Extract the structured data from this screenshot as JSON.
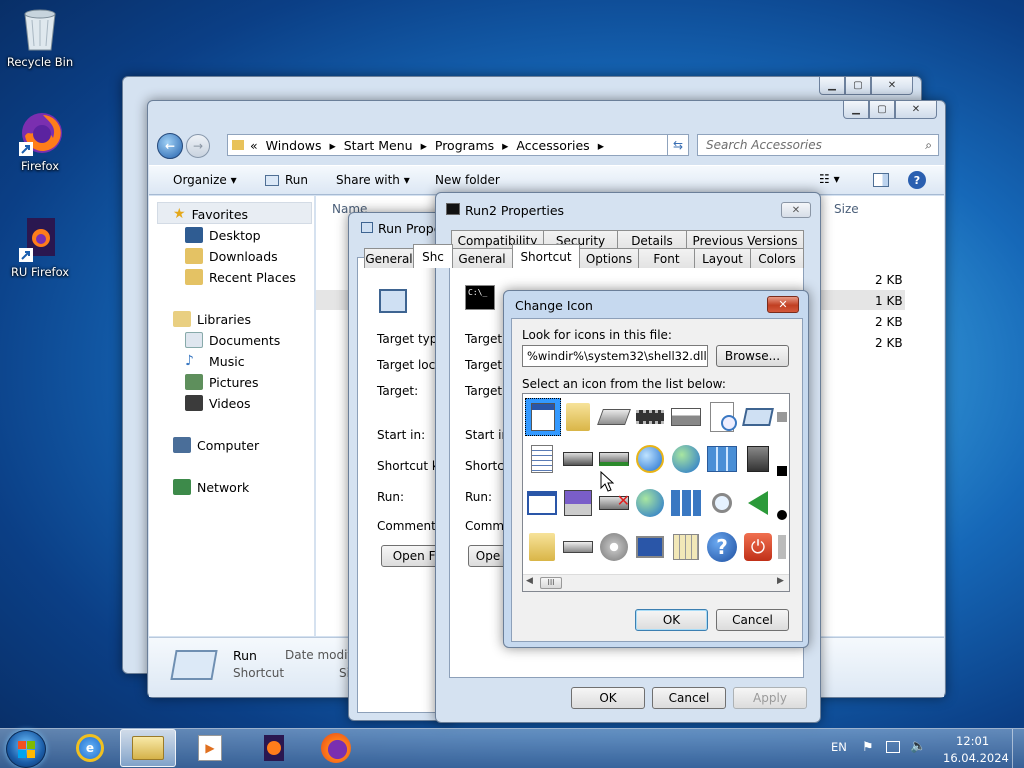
{
  "desktop": {
    "icons": [
      {
        "label": "Recycle Bin",
        "icon": "recycle-bin-icon"
      },
      {
        "label": "Firefox",
        "icon": "firefox-icon"
      },
      {
        "label": "RU Firefox",
        "icon": "firefox-icon"
      }
    ]
  },
  "explorer": {
    "address": [
      "«",
      "Windows",
      "Start Menu",
      "Programs",
      "Accessories"
    ],
    "search_placeholder": "Search Accessories",
    "toolbar": {
      "organize": "Organize",
      "run": "Run",
      "share_with": "Share with",
      "new_folder": "New folder"
    },
    "nav": {
      "favorites": "Favorites",
      "favorite_items": [
        "Desktop",
        "Downloads",
        "Recent Places"
      ],
      "libraries": "Libraries",
      "library_items": [
        "Documents",
        "Music",
        "Pictures",
        "Videos"
      ],
      "computer": "Computer",
      "network": "Network"
    },
    "columns": {
      "name": "Name",
      "size": "Size"
    },
    "sizes": [
      "2 KB",
      "1 KB",
      "2 KB",
      "2 KB"
    ],
    "details": {
      "name": "Run",
      "type": "Shortcut",
      "date_label": "Date modifie",
      "size_label": "Si"
    }
  },
  "run_props": {
    "title": "Run Proper",
    "tabs": [
      "General",
      "Shc"
    ],
    "fields": [
      "Target type:",
      "Target locati",
      "Target:",
      "Start in:",
      "Shortcut key",
      "Run:",
      "Comment:"
    ],
    "open_file": "Open Fil"
  },
  "run2_props": {
    "title": "Run2 Properties",
    "tabs_row1": [
      "Compatibility",
      "Security",
      "Details",
      "Previous Versions"
    ],
    "tabs_row2": [
      "General",
      "Shortcut",
      "Options",
      "Font",
      "Layout",
      "Colors"
    ],
    "fields": [
      "Target ty",
      "Target lo",
      "Target:",
      "Start in:",
      "Shortcut",
      "Run:",
      "Commen"
    ],
    "open_btn": "Ope",
    "ok": "OK",
    "cancel": "Cancel",
    "apply": "Apply"
  },
  "change_icon": {
    "title": "Change Icon",
    "look_label": "Look for icons in this file:",
    "file_path": "%windir%\\system32\\shell32.dll",
    "browse": "Browse...",
    "select_label": "Select an icon from the list below:",
    "ok": "OK",
    "cancel": "Cancel"
  },
  "taskbar": {
    "lang": "EN",
    "time": "12:01",
    "date": "16.04.2024"
  }
}
